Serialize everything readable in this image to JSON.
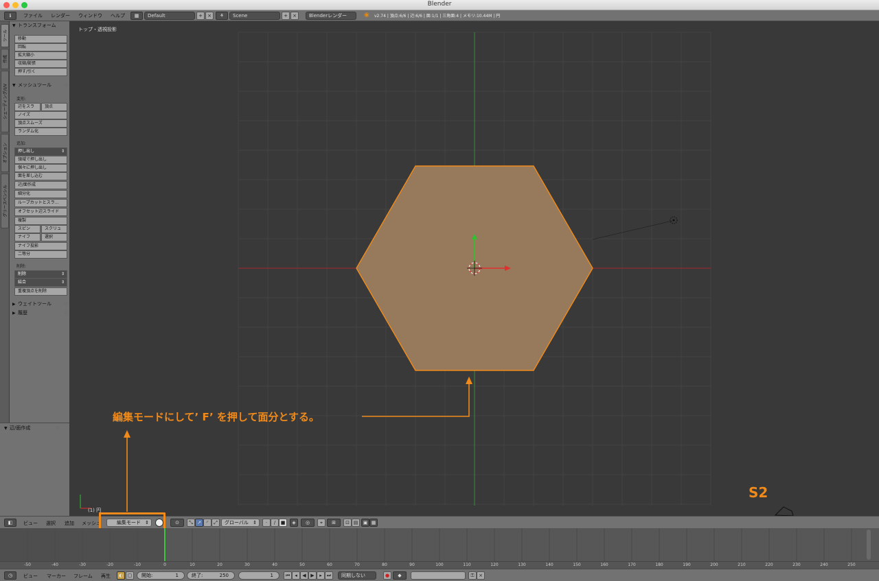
{
  "window": {
    "title": "Blender"
  },
  "topbar": {
    "menus": [
      "ファイル",
      "レンダー",
      "ウィンドウ",
      "ヘルプ"
    ],
    "layout": "Default",
    "scene": "Scene",
    "render_engine": "Blenderレンダー",
    "stats": "v2.74 | 頂点:6/6 | 辺:6/6 | 面:1/1 | 三角面:4 | メモリ:10.44M | 円"
  },
  "side_tabs": [
    "ツール",
    "作成",
    "シェーディング/UV",
    "オプション",
    "グリースペンシル"
  ],
  "toolshelf": {
    "transform": {
      "title": "トランスフォーム",
      "buttons": [
        "移動",
        "回転",
        "拡大縮小",
        "収縮/膨張",
        "押す/引く"
      ]
    },
    "mesh_tools": {
      "title": "メッシュツール",
      "deform_label": "変形:",
      "deform_row": [
        "辺をスラ",
        "頂点"
      ],
      "deform_buttons": [
        "ノイズ",
        "頂点スムーズ",
        "ランダム化"
      ],
      "add_label": "追加:",
      "extrude_select": "押し出し",
      "add_buttons": [
        "領域で押し出し",
        "個々に押し出し",
        "面を差し込む",
        "辺/面作成",
        "細分化",
        "ループカットとスラ...",
        "オフセット辺スライド",
        "複製"
      ],
      "add_row1": [
        "スピン",
        "スクリュ"
      ],
      "add_row2": [
        "ナイフ",
        "選択"
      ],
      "add_buttons2": [
        "ナイフ投影",
        "二等分"
      ],
      "remove_label": "削除:",
      "delete_select": "削除",
      "merge_select": "結合",
      "remove_doubles": "重複頂点を削除"
    },
    "weight_tools": {
      "title": "ウェイトツール"
    },
    "history": {
      "title": "履歴"
    }
  },
  "redo_panel": {
    "title": "辺/面作成"
  },
  "viewport": {
    "label": "トップ・透視投影",
    "object_info": "(1) 円",
    "grid_labels": [
      "S2"
    ]
  },
  "annotation": {
    "note": "編集モードにして’ F’ を押して面分とする。",
    "step": "S2",
    "color": "#f08a1a"
  },
  "view3d_header": {
    "menus": [
      "ビュー",
      "選択",
      "追加",
      "メッシュ"
    ],
    "mode": "編集モード",
    "orientation": "グローバル"
  },
  "timeline": {
    "ticks": [
      "-50",
      "-40",
      "-30",
      "-20",
      "-10",
      "0",
      "10",
      "20",
      "30",
      "40",
      "50",
      "60",
      "70",
      "80",
      "90",
      "100",
      "110",
      "120",
      "130",
      "140",
      "150",
      "160",
      "170",
      "180",
      "190",
      "200",
      "210",
      "220",
      "230",
      "240",
      "250"
    ]
  },
  "timeline_header": {
    "menus": [
      "ビュー",
      "マーカー",
      "フレーム",
      "再生"
    ],
    "start_label": "開始:",
    "start_value": "1",
    "end_label": "終了:",
    "end_value": "250",
    "current_frame": "1",
    "sync": "同期しない"
  },
  "colors": {
    "face": "#977a5c",
    "edge": "#f08a1a",
    "x_axis": "#a3262b",
    "y_axis": "#3a8a3a"
  }
}
